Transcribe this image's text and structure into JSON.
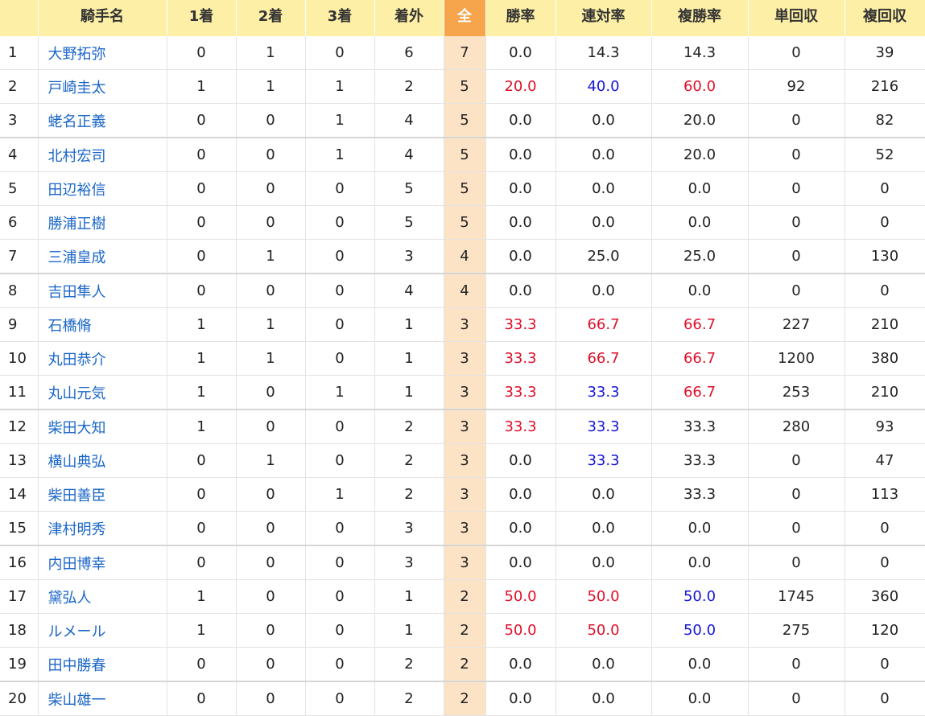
{
  "header": {
    "columns": [
      "",
      "騎手名",
      "1着",
      "2着",
      "3着",
      "着外",
      "全",
      "勝率",
      "連対率",
      "複勝率",
      "単回収",
      "複回収"
    ]
  },
  "colors": {
    "header_bg": "#fdefa6",
    "total_header_bg": "#f7a54d",
    "total_cell_bg": "#fde3c6",
    "link": "#1a66c8",
    "red": "#e0102a",
    "blue": "#1616d8"
  },
  "rows": [
    {
      "rank": "1",
      "name": "大野拓弥",
      "w1": "0",
      "w2": "1",
      "w3": "0",
      "out": "6",
      "total": "7",
      "win": "0.0",
      "quin": "14.3",
      "place": "14.3",
      "win_ret": "0",
      "place_ret": "39"
    },
    {
      "rank": "2",
      "name": "戸崎圭太",
      "w1": "1",
      "w2": "1",
      "w3": "1",
      "out": "2",
      "total": "5",
      "win": "20.0",
      "quin": "40.0",
      "place": "60.0",
      "win_ret": "92",
      "place_ret": "216"
    },
    {
      "rank": "3",
      "name": "蛯名正義",
      "w1": "0",
      "w2": "0",
      "w3": "1",
      "out": "4",
      "total": "5",
      "win": "0.0",
      "quin": "0.0",
      "place": "20.0",
      "win_ret": "0",
      "place_ret": "82"
    },
    {
      "rank": "4",
      "name": "北村宏司",
      "w1": "0",
      "w2": "0",
      "w3": "1",
      "out": "4",
      "total": "5",
      "win": "0.0",
      "quin": "0.0",
      "place": "20.0",
      "win_ret": "0",
      "place_ret": "52"
    },
    {
      "rank": "5",
      "name": "田辺裕信",
      "w1": "0",
      "w2": "0",
      "w3": "0",
      "out": "5",
      "total": "5",
      "win": "0.0",
      "quin": "0.0",
      "place": "0.0",
      "win_ret": "0",
      "place_ret": "0"
    },
    {
      "rank": "6",
      "name": "勝浦正樹",
      "w1": "0",
      "w2": "0",
      "w3": "0",
      "out": "5",
      "total": "5",
      "win": "0.0",
      "quin": "0.0",
      "place": "0.0",
      "win_ret": "0",
      "place_ret": "0"
    },
    {
      "rank": "7",
      "name": "三浦皇成",
      "w1": "0",
      "w2": "1",
      "w3": "0",
      "out": "3",
      "total": "4",
      "win": "0.0",
      "quin": "25.0",
      "place": "25.0",
      "win_ret": "0",
      "place_ret": "130"
    },
    {
      "rank": "8",
      "name": "吉田隼人",
      "w1": "0",
      "w2": "0",
      "w3": "0",
      "out": "4",
      "total": "4",
      "win": "0.0",
      "quin": "0.0",
      "place": "0.0",
      "win_ret": "0",
      "place_ret": "0"
    },
    {
      "rank": "9",
      "name": "石橋脩",
      "w1": "1",
      "w2": "1",
      "w3": "0",
      "out": "1",
      "total": "3",
      "win": "33.3",
      "quin": "66.7",
      "place": "66.7",
      "win_ret": "227",
      "place_ret": "210"
    },
    {
      "rank": "10",
      "name": "丸田恭介",
      "w1": "1",
      "w2": "1",
      "w3": "0",
      "out": "1",
      "total": "3",
      "win": "33.3",
      "quin": "66.7",
      "place": "66.7",
      "win_ret": "1200",
      "place_ret": "380"
    },
    {
      "rank": "11",
      "name": "丸山元気",
      "w1": "1",
      "w2": "0",
      "w3": "1",
      "out": "1",
      "total": "3",
      "win": "33.3",
      "quin": "33.3",
      "place": "66.7",
      "win_ret": "253",
      "place_ret": "210"
    },
    {
      "rank": "12",
      "name": "柴田大知",
      "w1": "1",
      "w2": "0",
      "w3": "0",
      "out": "2",
      "total": "3",
      "win": "33.3",
      "quin": "33.3",
      "place": "33.3",
      "win_ret": "280",
      "place_ret": "93"
    },
    {
      "rank": "13",
      "name": "横山典弘",
      "w1": "0",
      "w2": "1",
      "w3": "0",
      "out": "2",
      "total": "3",
      "win": "0.0",
      "quin": "33.3",
      "place": "33.3",
      "win_ret": "0",
      "place_ret": "47"
    },
    {
      "rank": "14",
      "name": "柴田善臣",
      "w1": "0",
      "w2": "0",
      "w3": "1",
      "out": "2",
      "total": "3",
      "win": "0.0",
      "quin": "0.0",
      "place": "33.3",
      "win_ret": "0",
      "place_ret": "113"
    },
    {
      "rank": "15",
      "name": "津村明秀",
      "w1": "0",
      "w2": "0",
      "w3": "0",
      "out": "3",
      "total": "3",
      "win": "0.0",
      "quin": "0.0",
      "place": "0.0",
      "win_ret": "0",
      "place_ret": "0"
    },
    {
      "rank": "16",
      "name": "内田博幸",
      "w1": "0",
      "w2": "0",
      "w3": "0",
      "out": "3",
      "total": "3",
      "win": "0.0",
      "quin": "0.0",
      "place": "0.0",
      "win_ret": "0",
      "place_ret": "0"
    },
    {
      "rank": "17",
      "name": "黛弘人",
      "w1": "1",
      "w2": "0",
      "w3": "0",
      "out": "1",
      "total": "2",
      "win": "50.0",
      "quin": "50.0",
      "place": "50.0",
      "win_ret": "1745",
      "place_ret": "360"
    },
    {
      "rank": "18",
      "name": "ルメール",
      "w1": "1",
      "w2": "0",
      "w3": "0",
      "out": "1",
      "total": "2",
      "win": "50.0",
      "quin": "50.0",
      "place": "50.0",
      "win_ret": "275",
      "place_ret": "120"
    },
    {
      "rank": "19",
      "name": "田中勝春",
      "w1": "0",
      "w2": "0",
      "w3": "0",
      "out": "2",
      "total": "2",
      "win": "0.0",
      "quin": "0.0",
      "place": "0.0",
      "win_ret": "0",
      "place_ret": "0"
    },
    {
      "rank": "20",
      "name": "柴山雄一",
      "w1": "0",
      "w2": "0",
      "w3": "0",
      "out": "2",
      "total": "2",
      "win": "0.0",
      "quin": "0.0",
      "place": "0.0",
      "win_ret": "0",
      "place_ret": "0"
    }
  ]
}
